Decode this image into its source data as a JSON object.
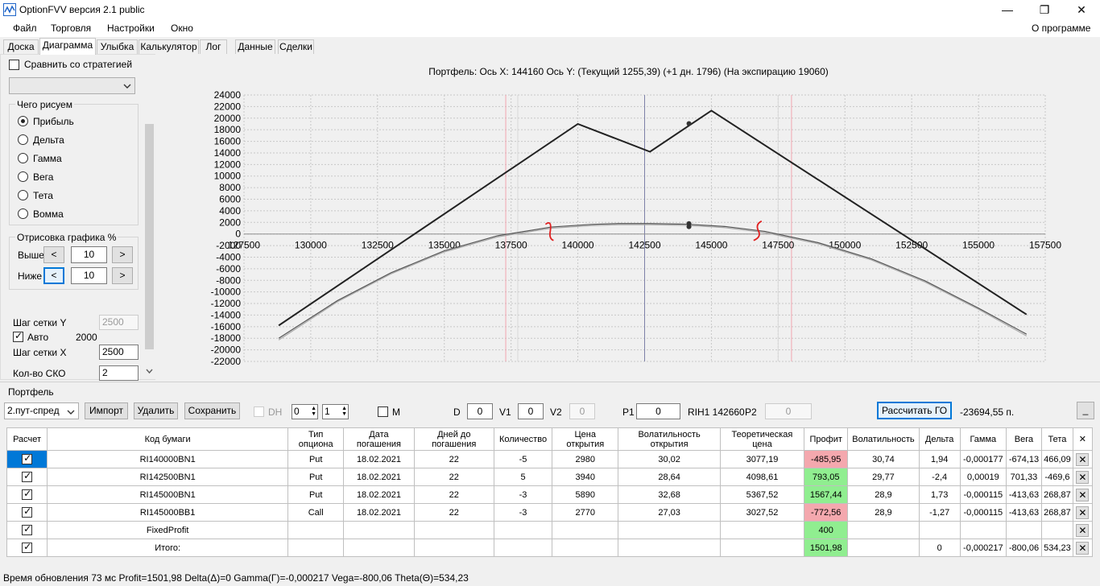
{
  "window": {
    "title": "OptionFVV версия 2.1 public",
    "minimize": "—",
    "maximize": "❐",
    "close": "✕"
  },
  "menu": {
    "items": [
      "Файл",
      "Торговля",
      "Настройки",
      "Окно"
    ],
    "about": "О программе"
  },
  "tabs": [
    "Доска",
    "Диаграмма",
    "Улыбка",
    "Калькулятор",
    "Лог",
    "Данные",
    "Сделки"
  ],
  "active_tab": "Диаграмма",
  "left": {
    "compare_label": "Сравнить со стратегией",
    "compare_checked": false,
    "draw_group": "Чего рисуем",
    "radios": [
      "Прибыль",
      "Дельта",
      "Гамма",
      "Вега",
      "Тета",
      "Вомма"
    ],
    "radio_selected": "Прибыль",
    "render_group": "Отрисовка графика %",
    "above_label": "Выше",
    "above_value": "10",
    "below_label": "Ниже",
    "below_value": "10",
    "left_arrow": "<",
    "right_arrow": ">",
    "grid_y_label": "Шаг сетки Y",
    "grid_y_value": "2500",
    "auto_label": "Авто",
    "auto_checked": true,
    "auto_value": "2000",
    "grid_x_label": "Шаг сетки X",
    "grid_x_value": "2500",
    "sko_label": "Кол-во СКО",
    "sko_value": "2"
  },
  "chart_data": {
    "type": "line",
    "title": "Портфель: Ось X: 144160 Ось Y:  (Текущий 1255,39)  (+1 дн. 1796)  (На экспирацию 19060)",
    "xlim": [
      127500,
      157500
    ],
    "ylim": [
      -22000,
      24000
    ],
    "x_ticks": [
      127500,
      130000,
      132500,
      135000,
      137500,
      140000,
      142500,
      145000,
      147500,
      150000,
      152500,
      155000,
      157500
    ],
    "y_ticks": [
      24000,
      22000,
      20000,
      18000,
      16000,
      14000,
      12000,
      10000,
      8000,
      6000,
      4000,
      2000,
      0,
      -2000,
      -4000,
      -6000,
      -8000,
      -10000,
      -12000,
      -14000,
      -16000,
      -18000,
      -20000,
      -22000
    ],
    "grid": true,
    "current_x": 142500,
    "sigma_lines": [
      137300,
      148000
    ],
    "inner_lines": [
      137750,
      147500
    ],
    "series": [
      {
        "color": "#222222",
        "x": [
          128800,
          140000,
          142700,
          145000,
          156800
        ],
        "y": [
          -15800,
          19000,
          14200,
          21300,
          -13900
        ]
      },
      {
        "color": "#555555",
        "x": [
          128800,
          131000,
          133000,
          135000,
          137000,
          139000,
          140500,
          141500,
          142700,
          144000,
          145500,
          147000,
          149000,
          151000,
          153000,
          155000,
          156800
        ],
        "y": [
          -18000,
          -11500,
          -6700,
          -2900,
          -300,
          1200,
          1650,
          1800,
          1800,
          1700,
          1300,
          450,
          -1500,
          -4300,
          -8100,
          -12800,
          -17300
        ]
      },
      {
        "color": "#aaaaaa",
        "x": [
          128800,
          131000,
          133000,
          135000,
          137000,
          139000,
          140500,
          141500,
          142700,
          144000,
          145500,
          147000,
          149000,
          151000,
          153000,
          155000,
          156800
        ],
        "y": [
          -18300,
          -11700,
          -6900,
          -3100,
          -500,
          1000,
          1450,
          1600,
          1600,
          1500,
          1100,
          250,
          -1700,
          -4500,
          -8300,
          -13000,
          -17600
        ]
      }
    ],
    "points": [
      {
        "x": 144160,
        "y": 19060
      },
      {
        "x": 144160,
        "y": 1796
      },
      {
        "x": 144160,
        "y": 1255
      }
    ]
  },
  "portfolio": {
    "label": "Портфель",
    "strategy": "2.пут-спред",
    "import": "Импорт",
    "delete": "Удалить",
    "save": "Сохранить",
    "dh_label": "DH",
    "spin1": "0",
    "spin2": "1",
    "m_label": "M",
    "d_label": "D",
    "d_value": "0",
    "v1_label": "V1",
    "v1_value": "0",
    "v2_label": "V2",
    "v2_value": "0",
    "p1_label": "P1",
    "p1_value": "0",
    "ticker": "RIH1 142660",
    "p2_label": "P2",
    "p2_value": "0",
    "calc_go": "Рассчитать ГО",
    "go_value": "-23694,55 п.",
    "minimize": "_"
  },
  "table": {
    "headers": [
      "Расчет",
      "Код бумаги",
      "Тип\nопциона",
      "Дата\nпогашения",
      "Дней до\nпогашения",
      "Количество",
      "Цена\nоткрытия",
      "Волатильность\nоткрытия",
      "Теоретическая\nцена",
      "Профит",
      "Волатильность",
      "Дельта",
      "Гамма",
      "Вега",
      "Тета",
      "✕"
    ],
    "rows": [
      {
        "checked": true,
        "code": "RI140000BN1",
        "type": "Put",
        "date": "18.02.2021",
        "days": "22",
        "qty": "-5",
        "price": "2980",
        "vol_open": "30,02",
        "theo": "3077,19",
        "profit": "-485,95",
        "profit_color": "neg",
        "vol": "30,74",
        "delta": "1,94",
        "gamma": "-0,000177",
        "vega": "-674,13",
        "theta": "466,09"
      },
      {
        "checked": true,
        "code": "RI142500BN1",
        "type": "Put",
        "date": "18.02.2021",
        "days": "22",
        "qty": "5",
        "price": "3940",
        "vol_open": "28,64",
        "theo": "4098,61",
        "profit": "793,05",
        "profit_color": "pos",
        "vol": "29,77",
        "delta": "-2,4",
        "gamma": "0,00019",
        "vega": "701,33",
        "theta": "-469,6"
      },
      {
        "checked": true,
        "code": "RI145000BN1",
        "type": "Put",
        "date": "18.02.2021",
        "days": "22",
        "qty": "-3",
        "price": "5890",
        "vol_open": "32,68",
        "theo": "5367,52",
        "profit": "1567,44",
        "profit_color": "pos",
        "vol": "28,9",
        "delta": "1,73",
        "gamma": "-0,000115",
        "vega": "-413,63",
        "theta": "268,87"
      },
      {
        "checked": true,
        "code": "RI145000BB1",
        "type": "Call",
        "date": "18.02.2021",
        "days": "22",
        "qty": "-3",
        "price": "2770",
        "vol_open": "27,03",
        "theo": "3027,52",
        "profit": "-772,56",
        "profit_color": "neg",
        "vol": "28,9",
        "delta": "-1,27",
        "gamma": "-0,000115",
        "vega": "-413,63",
        "theta": "268,87"
      },
      {
        "checked": true,
        "code": "FixedProfit",
        "type": "",
        "date": "",
        "days": "",
        "qty": "",
        "price": "",
        "vol_open": "",
        "theo": "",
        "profit": "400",
        "profit_color": "pos",
        "vol": "",
        "delta": "",
        "gamma": "",
        "vega": "",
        "theta": ""
      },
      {
        "checked": true,
        "code": "Итого:",
        "type": "",
        "date": "",
        "days": "",
        "qty": "",
        "price": "",
        "vol_open": "",
        "theo": "",
        "profit": "1501,98",
        "profit_color": "pos",
        "vol": "",
        "delta": "0",
        "gamma": "-0,000217",
        "vega": "-800,06",
        "theta": "534,23"
      }
    ],
    "row_close": "✕"
  },
  "status": {
    "text": "Время обновления 73 мс  Profit=1501,98 Delta(Δ)=0 Gamma(Γ)=-0,000217 Vega=-800,06 Theta(Θ)=534,23"
  }
}
